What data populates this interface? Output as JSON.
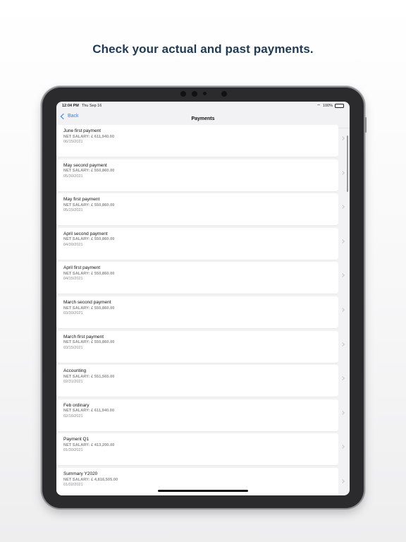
{
  "headline": "Check your actual and past payments.",
  "status": {
    "time": "12:04 PM",
    "date": "Thu Sep 16",
    "battery": "100%"
  },
  "nav": {
    "back_label": "Back",
    "title": "Payments"
  },
  "payments": [
    {
      "title": "June first payment",
      "salary": "NET SALARY: £ 611,940.00",
      "date": "06/15/2021"
    },
    {
      "title": "May second payment",
      "salary": "NET SALARY: £ 550,860.00",
      "date": "05/30/2021"
    },
    {
      "title": "May first payment",
      "salary": "NET SALARY: £ 550,860.00",
      "date": "05/15/2021"
    },
    {
      "title": "April second payment",
      "salary": "NET SALARY: £ 550,860.00",
      "date": "04/30/2021"
    },
    {
      "title": "April first payment",
      "salary": "NET SALARY: £ 550,860.00",
      "date": "04/15/2021"
    },
    {
      "title": "March second payment",
      "salary": "NET SALARY: £ 550,860.00",
      "date": "03/30/2021"
    },
    {
      "title": "March first payment",
      "salary": "NET SALARY: £ 550,860.00",
      "date": "03/15/2021"
    },
    {
      "title": "Accounting",
      "salary": "NET SALARY: £ 551,565.00",
      "date": "02/31/2021"
    },
    {
      "title": "Feb ordinary",
      "salary": "NET SALARY: £ 611,940.00",
      "date": "02/16/2021"
    },
    {
      "title": "Payment Q1",
      "salary": "NET SALARY: £ 413,200.00",
      "date": "01/30/2021"
    },
    {
      "title": "Summary Y2020",
      "salary": "NET SALARY: £ 4,816,505.00",
      "date": "01/02/2021"
    }
  ],
  "icons": {
    "back": "chevron-left-icon",
    "row_arrow": "chevron-right-icon",
    "wifi": "wifi-icon",
    "battery": "battery-icon"
  },
  "colors": {
    "accent": "#2f7ff5",
    "headline": "#1f3a55"
  }
}
